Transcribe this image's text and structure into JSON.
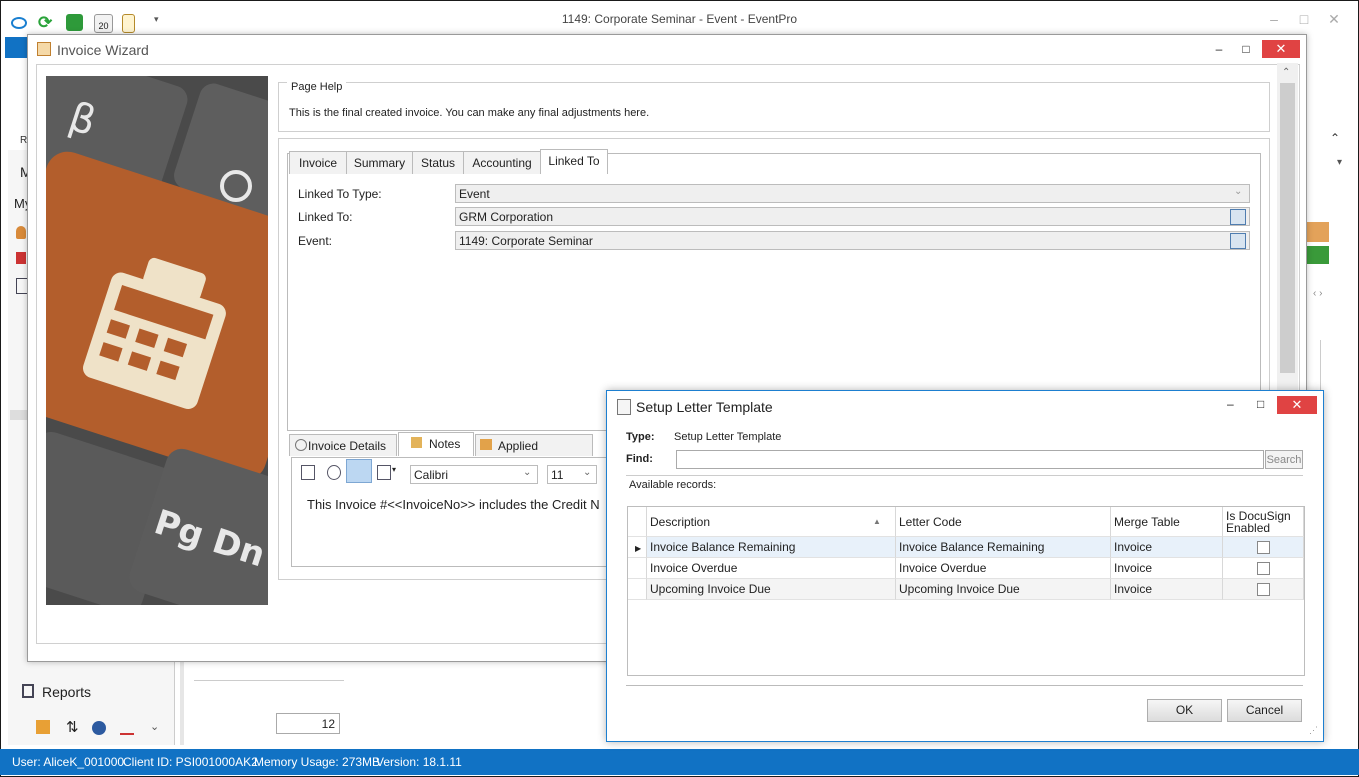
{
  "app": {
    "title": "1149: Corporate Seminar - Event - EventPro",
    "controls": {
      "minimize": "–",
      "maximize": "□",
      "close": "✕"
    },
    "partial_labels": {
      "r": "R",
      "m1": "M",
      "m2": "My"
    },
    "reports_label": "Reports",
    "pager_value": "12",
    "colors": {
      "accent": "#1172c4",
      "close": "#e04343"
    }
  },
  "status_bar": {
    "user": "User: AliceK_001000",
    "client_id": "Client ID: PSI001000AK2",
    "memory": "Memory Usage: 273MB",
    "version": "Version: 18.1.11"
  },
  "wizard": {
    "title": "Invoice Wizard",
    "page_help": {
      "legend": "Page Help",
      "text": "This is the final created invoice.  You can make any final adjustments here."
    },
    "tabs": [
      "Invoice",
      "Summary",
      "Status",
      "Accounting",
      "Linked To"
    ],
    "active_tab": "Linked To",
    "linked": {
      "type_label": "Linked To Type:",
      "type_value": "Event",
      "to_label": "Linked To:",
      "to_value": "GRM Corporation",
      "event_label": "Event:",
      "event_value": "1149: Corporate Seminar"
    },
    "bottom_tabs": [
      "Invoice Details",
      "Notes",
      "Applied Payments"
    ],
    "active_bottom_tab": "Notes",
    "editor": {
      "font": "Calibri",
      "size": "11",
      "text": "This Invoice #<<InvoiceNo>> includes the Credit N"
    }
  },
  "dialog": {
    "title": "Setup Letter Template",
    "type_label": "Type:",
    "type_value": "Setup Letter Template",
    "find_label": "Find:",
    "find_value": "",
    "search_button": "Search",
    "available_label": "Available records:",
    "columns": [
      "Description",
      "Letter Code",
      "Merge Table",
      "Is DocuSign Enabled"
    ],
    "rows": [
      {
        "description": "Invoice Balance Remaining",
        "letter_code": "Invoice Balance Remaining",
        "merge_table": "Invoice",
        "docusign": false
      },
      {
        "description": "Invoice Overdue",
        "letter_code": "Invoice Overdue",
        "merge_table": "Invoice",
        "docusign": false
      },
      {
        "description": "Upcoming Invoice Due",
        "letter_code": "Upcoming Invoice Due",
        "merge_table": "Invoice",
        "docusign": false
      }
    ],
    "ok_button": "OK",
    "cancel_button": "Cancel"
  }
}
